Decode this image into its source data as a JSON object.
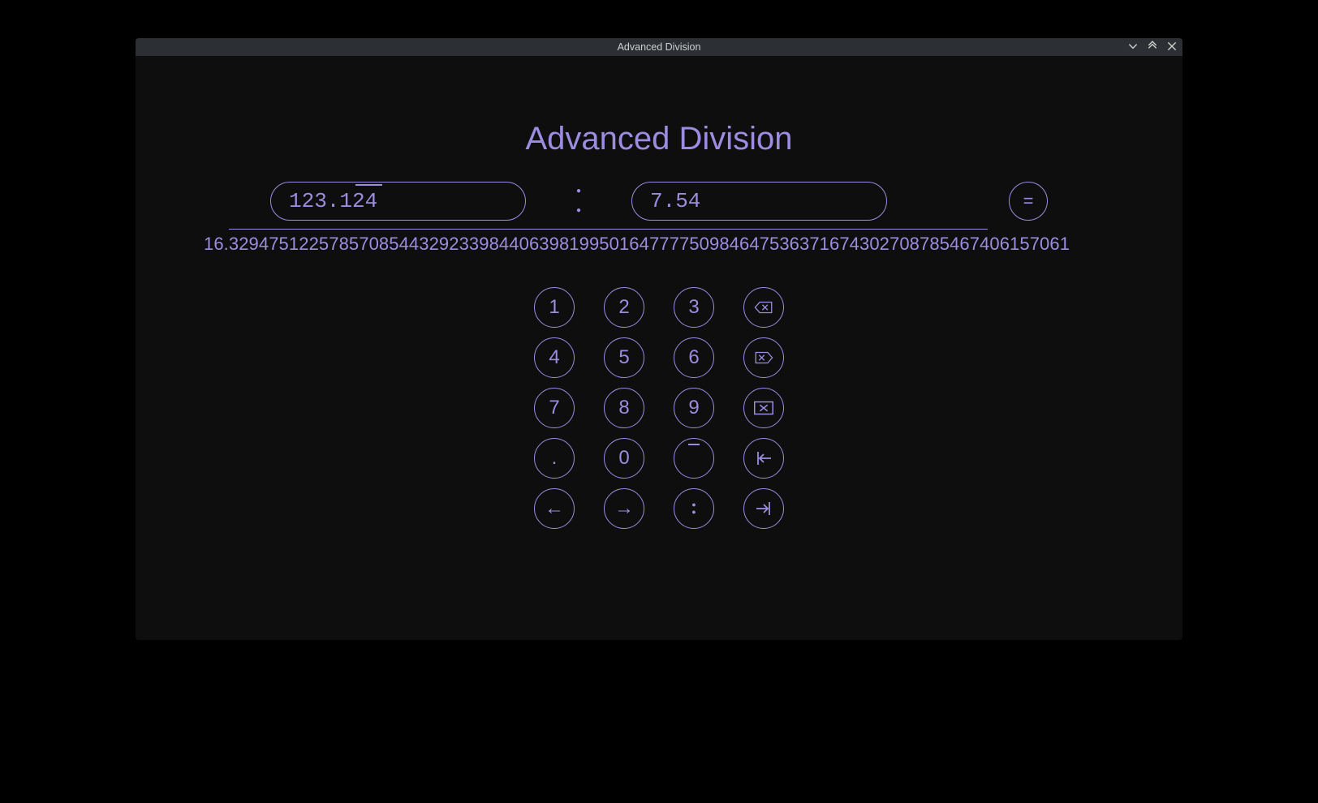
{
  "window": {
    "title": "Advanced Division"
  },
  "heading": "Advanced Division",
  "inputs": {
    "dividend": "123.124",
    "divisor": "7.54",
    "dividend_overline_segment": "24"
  },
  "operator_symbol": ":",
  "equals_label": "=",
  "result": "16.329475122578570854432923398440639819950164777750984647536371674302708785467406157061",
  "keypad": {
    "keys": [
      {
        "label": "1",
        "name": "key-1"
      },
      {
        "label": "2",
        "name": "key-2"
      },
      {
        "label": "3",
        "name": "key-3"
      },
      {
        "label": "backspace",
        "name": "key-backspace",
        "icon": "backspace"
      },
      {
        "label": "4",
        "name": "key-4"
      },
      {
        "label": "5",
        "name": "key-5"
      },
      {
        "label": "6",
        "name": "key-6"
      },
      {
        "label": "delete-forward",
        "name": "key-delete-forward",
        "icon": "delete-forward"
      },
      {
        "label": "7",
        "name": "key-7"
      },
      {
        "label": "8",
        "name": "key-8"
      },
      {
        "label": "9",
        "name": "key-9"
      },
      {
        "label": "clear",
        "name": "key-clear",
        "icon": "clear-box"
      },
      {
        "label": ".",
        "name": "key-dot"
      },
      {
        "label": "0",
        "name": "key-0"
      },
      {
        "label": "overline",
        "name": "key-overline",
        "icon": "overline"
      },
      {
        "label": "home",
        "name": "key-home",
        "icon": "arrow-bar-left"
      },
      {
        "label": "←",
        "name": "key-left"
      },
      {
        "label": "→",
        "name": "key-right"
      },
      {
        "label": ":",
        "name": "key-colon",
        "icon": "colon"
      },
      {
        "label": "end",
        "name": "key-end",
        "icon": "arrow-bar-right"
      }
    ]
  },
  "colors": {
    "accent": "#9d8ce0",
    "background": "#0e0e0e",
    "titlebar": "#2c2f33"
  }
}
